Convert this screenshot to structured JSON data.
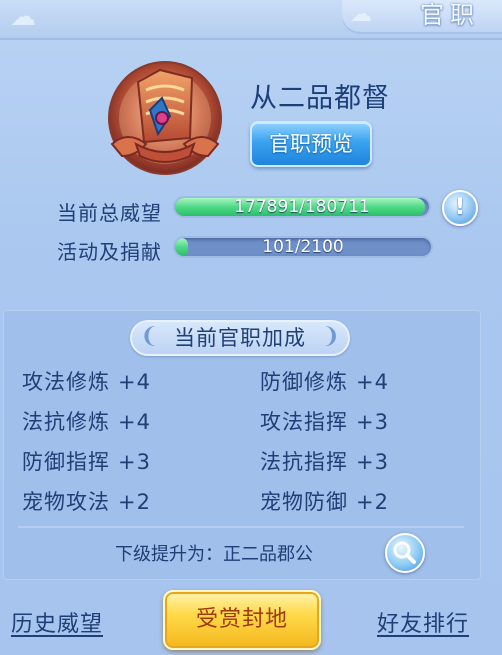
{
  "header": {
    "title": "官职"
  },
  "rank": {
    "current_name": "从二品都督",
    "preview_button": "官职预览"
  },
  "progress": {
    "prestige": {
      "label": "当前总威望",
      "text": "177891/180711",
      "value": 177891,
      "max": 180711
    },
    "donation": {
      "label": "活动及捐献",
      "text": "101/2100",
      "value": 101,
      "max": 2100
    }
  },
  "bonus": {
    "title": "当前官职加成",
    "items": [
      {
        "name": "攻法修炼",
        "value": "+4"
      },
      {
        "name": "防御修炼",
        "value": "+4"
      },
      {
        "name": "法抗修炼",
        "value": "+4"
      },
      {
        "name": "攻法指挥",
        "value": "+3"
      },
      {
        "name": "防御指挥",
        "value": "+3"
      },
      {
        "name": "法抗指挥",
        "value": "+3"
      },
      {
        "name": "宠物攻法",
        "value": "+2"
      },
      {
        "name": "宠物防御",
        "value": "+2"
      }
    ],
    "next_rank": "下级提升为：正二品郡公"
  },
  "footer": {
    "history": "历史威望",
    "reward": "受赏封地",
    "ranking": "好友排行"
  },
  "colors": {
    "background": "#a9c7ef",
    "text": "#1f3f76",
    "progress_fill": "#4fd986",
    "reward_button": "#ffd94a"
  }
}
